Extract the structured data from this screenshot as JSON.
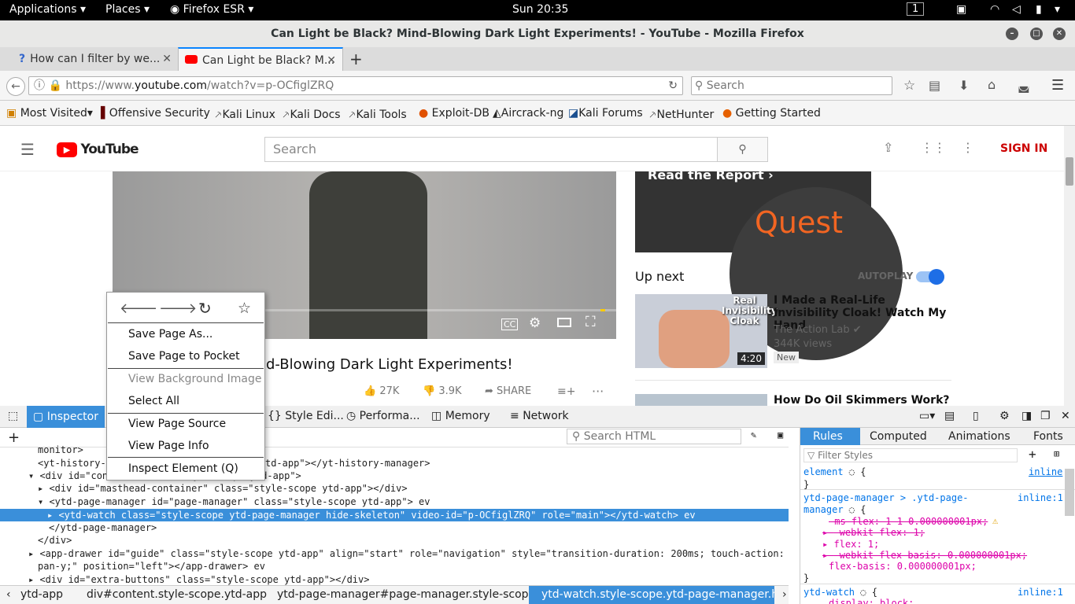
{
  "topbar": {
    "applications": "Applications",
    "places": "Places",
    "firefox": "Firefox ESR",
    "clock": "Sun 20:35",
    "workspace": "1"
  },
  "window": {
    "title": "Can Light be Black? Mind-Blowing Dark Light Experiments! - YouTube - Mozilla Firefox"
  },
  "tabs": [
    {
      "label": "How can I filter by we..."
    },
    {
      "label": "Can Light be Black? M..."
    }
  ],
  "nav": {
    "url_prefix": "https://www.",
    "url_domain": "youtube.com",
    "url_path": "/watch?v=p-OCfiglZRQ",
    "search_placeholder": "Search"
  },
  "bookmarks": [
    "Most Visited",
    "Offensive Security",
    "Kali Linux",
    "Kali Docs",
    "Kali Tools",
    "Exploit-DB",
    "Aircrack-ng",
    "Kali Forums",
    "NetHunter",
    "Getting Started"
  ],
  "youtube": {
    "logo": "YouTube",
    "search_placeholder": "Search",
    "sign_in": "SIGN IN",
    "ad_text": "Read the Report ›",
    "ad_brand": "Quest",
    "up_next": "Up next",
    "autoplay": "AUTOPLAY",
    "video_title_visible": "d-Blowing Dark Light Experiments!",
    "likes": "27K",
    "dislikes": "3.9K",
    "share": "SHARE",
    "recs": [
      {
        "title": "I Made a Real-Life Invisibility Cloak! Watch My Hand",
        "channel": "The Action Lab",
        "views": "344K views",
        "badge": "New",
        "duration": "4:20",
        "thumb_text": "Real Invisibility Cloak"
      },
      {
        "title": "How Do Oil Skimmers Work?"
      }
    ]
  },
  "devtools": {
    "tabs": [
      "Inspector",
      "Style Edi...",
      "Performa...",
      "Memory",
      "Network"
    ],
    "search_html": "Search HTML",
    "side_tabs": [
      "Rules",
      "Computed",
      "Animations",
      "Fonts"
    ],
    "filter_styles": "Filter Styles",
    "markup": [
      {
        "text": "monitor>",
        "indent": "i1"
      },
      {
        "text": "<yt-history-manager class=\"style-scope ytd-app\"></yt-history-manager>",
        "indent": "i1"
      },
      {
        "text": "▾ <div id=\"content\" class=\"style-scope ytd-app\">",
        "indent": "i0"
      },
      {
        "text": "▸ <div id=\"masthead-container\" class=\"style-scope ytd-app\"></div>",
        "indent": "i1"
      },
      {
        "text": "▾ <ytd-page-manager id=\"page-manager\" class=\"style-scope ytd-app\"> ev",
        "indent": "i1"
      },
      {
        "text": "▸ <ytd-watch class=\"style-scope ytd-page-manager hide-skeleton\" video-id=\"p-OCfiglZRQ\" role=\"main\"></ytd-watch> ev",
        "indent": "i2"
      },
      {
        "text": "</ytd-page-manager>",
        "indent": "i2"
      },
      {
        "text": "</div>",
        "indent": "i1"
      },
      {
        "text": "▸ <app-drawer id=\"guide\" class=\"style-scope ytd-app\" align=\"start\" role=\"navigation\" style=\"transition-duration: 200ms; touch-action:",
        "indent": "i0"
      },
      {
        "text": "pan-y;\" position=\"left\"></app-drawer> ev",
        "indent": "i0"
      },
      {
        "text": "▸ <div id=\"extra-buttons\" class=\"style-scope ytd-app\"></div>",
        "indent": "i0"
      }
    ],
    "breadcrumbs": [
      "ytd-app",
      "div#content.style-scope.ytd-app",
      "ytd-page-manager#page-manager.style-scop...",
      "ytd-watch.style-scope.ytd-page-manager.h..."
    ],
    "rules": [
      {
        "sel": "element",
        "src": "inline"
      },
      {
        "sel": "ytd-page-manager > .ytd-page-",
        "sel2": "manager",
        "src": "inline:1"
      },
      {
        "decls": [
          "-ms-flex: 1 1 0.000000001px;",
          "-webkit-flex: 1;",
          "flex: 1;",
          "-webkit-flex-basis: 0.000000001px;",
          "flex-basis: 0.000000001px;"
        ]
      },
      {
        "sel": "ytd-watch",
        "src": "inline:1",
        "decl": "display: block;"
      }
    ]
  },
  "context_menu": [
    "Save Page As...",
    "Save Page to Pocket",
    "View Background Image",
    "Select All",
    "View Page Source",
    "View Page Info",
    "Inspect Element (Q)"
  ]
}
